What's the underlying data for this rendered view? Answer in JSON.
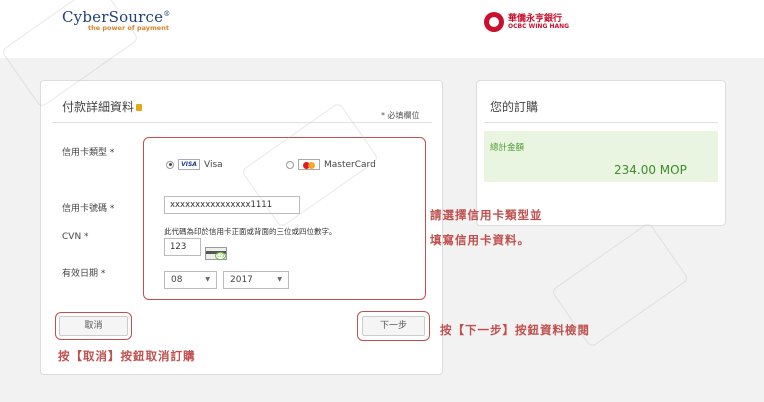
{
  "header": {
    "cybersource_name": "CyberSource",
    "cybersource_tagline": "the power of payment",
    "bank_name_cn": "華僑永亨銀行",
    "bank_name_en": "OCBC WING HANG"
  },
  "payment_form": {
    "title": "付款詳細資料",
    "required_note": "* 必填欄位",
    "card_type_label": "信用卡類型 *",
    "card_options": [
      {
        "label": "Visa",
        "icon": "visa-icon",
        "selected": true
      },
      {
        "label": "MasterCard",
        "icon": "mastercard-icon",
        "selected": false
      }
    ],
    "card_number_label": "信用卡號碼 *",
    "card_number_value": "xxxxxxxxxxxxxxxx1111",
    "cvn_helper": "此代碼為印於信用卡正面或背面的三位或四位數字。",
    "cvn_label": "CVN *",
    "cvn_value": "123",
    "expiry_label": "有效日期 *",
    "expiry_month": "08",
    "expiry_year": "2017",
    "cancel_button": "取消",
    "next_button": "下一步"
  },
  "order": {
    "title": "您的訂購",
    "total_label": "總計金額",
    "total_value": "234.00 MOP"
  },
  "annotations": {
    "card_instruction_line1": "請選擇信用卡類型並",
    "card_instruction_line2": "填寫信用卡資料。",
    "next_instruction": "按【下一步】按鈕資料檢閱",
    "cancel_instruction": "按【取消】按鈕取消訂購"
  },
  "colors": {
    "annotation_red": "#c0504d",
    "total_green": "#3d8b2a",
    "total_bg": "#e9f5e1"
  }
}
